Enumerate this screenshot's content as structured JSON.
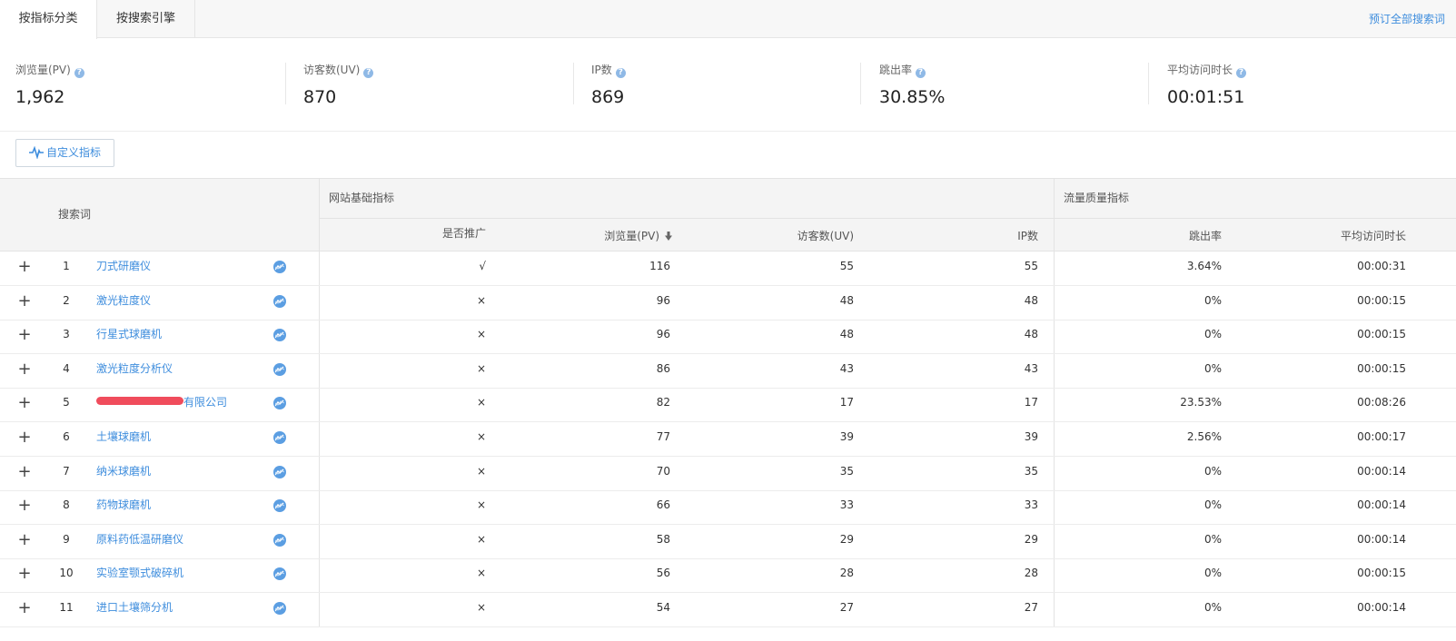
{
  "tabs": [
    {
      "label": "按指标分类",
      "active": true
    },
    {
      "label": "按搜索引擎",
      "active": false
    }
  ],
  "top_link": "预订全部搜索词",
  "summary": [
    {
      "label": "浏览量(PV)",
      "value": "1,962"
    },
    {
      "label": "访客数(UV)",
      "value": "870"
    },
    {
      "label": "IP数",
      "value": "869"
    },
    {
      "label": "跳出率",
      "value": "30.85%"
    },
    {
      "label": "平均访问时长",
      "value": "00:01:51"
    }
  ],
  "custom_button": "自定义指标",
  "table": {
    "group_headers": {
      "basic": "网站基础指标",
      "quality": "流量质量指标"
    },
    "columns": {
      "keyword": "搜索词",
      "promoted": "是否推广",
      "pv": "浏览量(PV)",
      "uv": "访客数(UV)",
      "ip": "IP数",
      "bounce": "跳出率",
      "duration": "平均访问时长"
    },
    "rows": [
      {
        "index": "1",
        "keyword": "刀式研磨仪",
        "promoted": "√",
        "pv": "116",
        "uv": "55",
        "ip": "55",
        "bounce": "3.64%",
        "duration": "00:00:31"
      },
      {
        "index": "2",
        "keyword": "激光粒度仪",
        "promoted": "×",
        "pv": "96",
        "uv": "48",
        "ip": "48",
        "bounce": "0%",
        "duration": "00:00:15"
      },
      {
        "index": "3",
        "keyword": "行星式球磨机",
        "promoted": "×",
        "pv": "96",
        "uv": "48",
        "ip": "48",
        "bounce": "0%",
        "duration": "00:00:15"
      },
      {
        "index": "4",
        "keyword": "激光粒度分析仪",
        "promoted": "×",
        "pv": "86",
        "uv": "43",
        "ip": "43",
        "bounce": "0%",
        "duration": "00:00:15"
      },
      {
        "index": "5",
        "keyword": "有限公司",
        "promoted": "×",
        "pv": "82",
        "uv": "17",
        "ip": "17",
        "bounce": "23.53%",
        "duration": "00:08:26",
        "redacted": true
      },
      {
        "index": "6",
        "keyword": "土壤球磨机",
        "promoted": "×",
        "pv": "77",
        "uv": "39",
        "ip": "39",
        "bounce": "2.56%",
        "duration": "00:00:17"
      },
      {
        "index": "7",
        "keyword": "纳米球磨机",
        "promoted": "×",
        "pv": "70",
        "uv": "35",
        "ip": "35",
        "bounce": "0%",
        "duration": "00:00:14"
      },
      {
        "index": "8",
        "keyword": "药物球磨机",
        "promoted": "×",
        "pv": "66",
        "uv": "33",
        "ip": "33",
        "bounce": "0%",
        "duration": "00:00:14"
      },
      {
        "index": "9",
        "keyword": "原料药低温研磨仪",
        "promoted": "×",
        "pv": "58",
        "uv": "29",
        "ip": "29",
        "bounce": "0%",
        "duration": "00:00:14"
      },
      {
        "index": "10",
        "keyword": "实验室颚式破碎机",
        "promoted": "×",
        "pv": "56",
        "uv": "28",
        "ip": "28",
        "bounce": "0%",
        "duration": "00:00:15"
      },
      {
        "index": "11",
        "keyword": "进口土壤筛分机",
        "promoted": "×",
        "pv": "54",
        "uv": "27",
        "ip": "27",
        "bounce": "0%",
        "duration": "00:00:14"
      }
    ]
  },
  "colors": {
    "accent": "#3e8ddd",
    "redaction": "#f04c5c"
  }
}
